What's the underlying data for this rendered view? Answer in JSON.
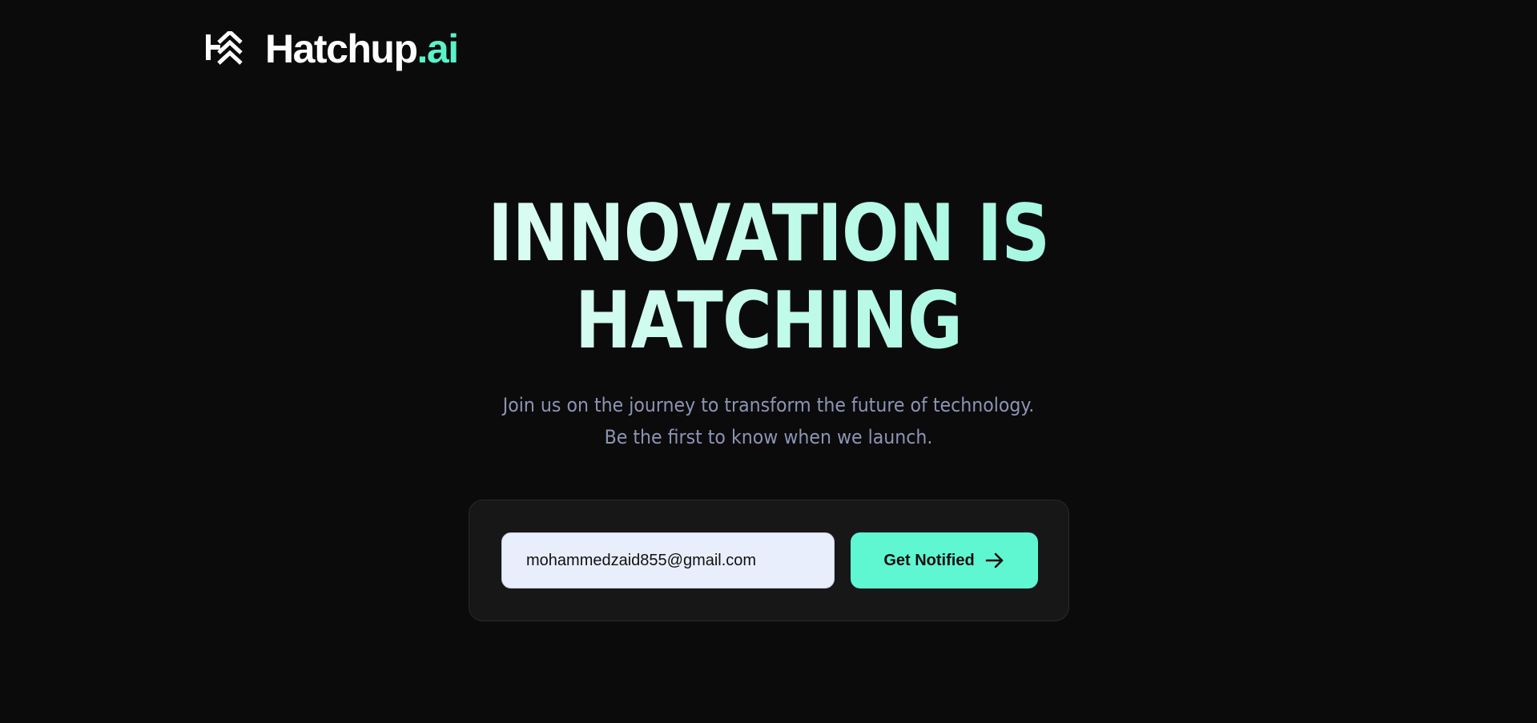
{
  "brand": {
    "name": "Hatchup",
    "extension": ".ai",
    "logo_icon": "hatchup-logo-icon",
    "accent_color": "#5cf2c9"
  },
  "hero": {
    "title_line_1": "INNOVATION IS",
    "title_line_2": "HATCHING",
    "subtitle_line_1": "Join us on the journey to transform the future of technology.",
    "subtitle_line_2": "Be the first to know when we launch."
  },
  "signup": {
    "email_value": "mohammedzaid855@gmail.com",
    "button_label": "Get Notified",
    "button_icon": "arrow-right-icon",
    "button_color": "#5ff7d2"
  },
  "colors": {
    "background": "#0b0b0b",
    "card": "#171717",
    "subtitle": "#8d94b4"
  }
}
